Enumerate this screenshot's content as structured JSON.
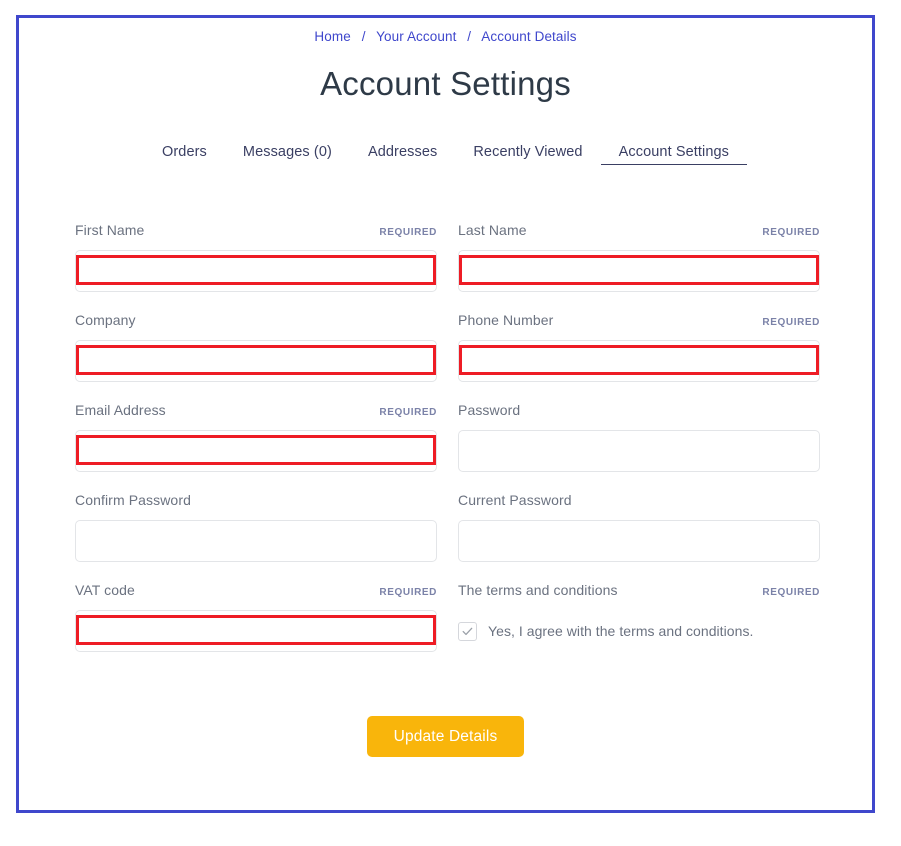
{
  "breadcrumb": {
    "items": [
      {
        "label": "Home"
      },
      {
        "label": "Your Account"
      },
      {
        "label": "Account Details"
      }
    ],
    "separator": "/",
    "color": "#3f47cc"
  },
  "header": {
    "title": "Account Settings"
  },
  "tabs": [
    {
      "label": "Orders",
      "active": false
    },
    {
      "label": "Messages (0)",
      "active": false
    },
    {
      "label": "Addresses",
      "active": false
    },
    {
      "label": "Recently Viewed",
      "active": false
    },
    {
      "label": "Account Settings",
      "active": true
    }
  ],
  "form": {
    "required_label": "REQUIRED",
    "fields": [
      {
        "name": "first-name",
        "label": "First Name",
        "required": true,
        "value": "",
        "placeholder": "",
        "type": "text",
        "highlighted": true
      },
      {
        "name": "last-name",
        "label": "Last Name",
        "required": true,
        "value": "",
        "placeholder": "",
        "type": "text",
        "highlighted": true
      },
      {
        "name": "company",
        "label": "Company",
        "required": false,
        "value": "",
        "placeholder": "",
        "type": "text",
        "highlighted": true
      },
      {
        "name": "phone-number",
        "label": "Phone Number",
        "required": true,
        "value": "",
        "placeholder": "",
        "type": "text",
        "highlighted": true
      },
      {
        "name": "email-address",
        "label": "Email Address",
        "required": true,
        "value": "",
        "placeholder": "",
        "type": "text",
        "highlighted": true
      },
      {
        "name": "password",
        "label": "Password",
        "required": false,
        "value": "",
        "placeholder": "",
        "type": "password",
        "highlighted": false
      },
      {
        "name": "confirm-password",
        "label": "Confirm Password",
        "required": false,
        "value": "",
        "placeholder": "",
        "type": "password",
        "highlighted": false
      },
      {
        "name": "current-password",
        "label": "Current Password",
        "required": false,
        "value": "",
        "placeholder": "",
        "type": "password",
        "highlighted": false
      },
      {
        "name": "vat-code",
        "label": "VAT code",
        "required": true,
        "value": "",
        "placeholder": "",
        "type": "text",
        "highlighted": true
      },
      {
        "name": "terms",
        "label": "The terms and conditions",
        "required": true,
        "type": "checkbox",
        "highlighted": false,
        "checkbox_label": "Yes, I agree with the terms and conditions.",
        "checked": true
      }
    ]
  },
  "submit": {
    "label": "Update Details",
    "color": "#f9b50b"
  },
  "annotation": {
    "box_color": "#ee1c25",
    "frame_color": "#3f47cc"
  }
}
